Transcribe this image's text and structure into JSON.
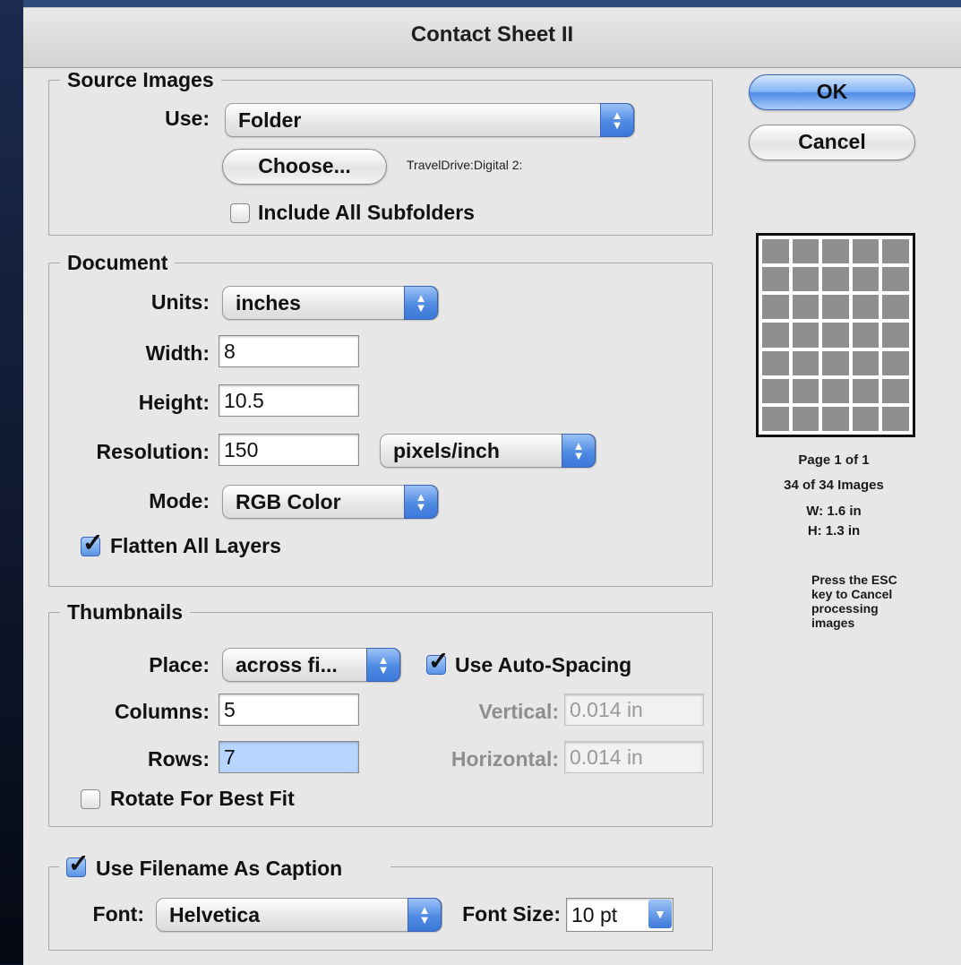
{
  "window": {
    "title": "Contact Sheet II"
  },
  "buttons": {
    "ok": "OK",
    "cancel": "Cancel"
  },
  "source_images": {
    "legend": "Source Images",
    "use_label": "Use:",
    "use_value": "Folder",
    "choose_label": "Choose...",
    "path": "TravelDrive:Digital 2:",
    "include_subfolders": {
      "label": "Include All Subfolders",
      "checked": false
    }
  },
  "document": {
    "legend": "Document",
    "units_label": "Units:",
    "units_value": "inches",
    "width_label": "Width:",
    "width_value": "8",
    "height_label": "Height:",
    "height_value": "10.5",
    "resolution_label": "Resolution:",
    "resolution_value": "150",
    "resolution_units": "pixels/inch",
    "mode_label": "Mode:",
    "mode_value": "RGB Color",
    "flatten": {
      "label": "Flatten All Layers",
      "checked": true
    }
  },
  "thumbnails": {
    "legend": "Thumbnails",
    "place_label": "Place:",
    "place_value": "across fi...",
    "auto_spacing": {
      "label": "Use Auto-Spacing",
      "checked": true
    },
    "columns_label": "Columns:",
    "columns_value": "5",
    "rows_label": "Rows:",
    "rows_value": "7",
    "vertical_label": "Vertical:",
    "vertical_value": "0.014 in",
    "horizontal_label": "Horizontal:",
    "horizontal_value": "0.014 in",
    "rotate": {
      "label": "Rotate For Best Fit",
      "checked": false
    }
  },
  "caption": {
    "use_filename": {
      "label": "Use Filename As Caption",
      "checked": true
    },
    "font_label": "Font:",
    "font_value": "Helvetica",
    "font_size_label": "Font Size:",
    "font_size_value": "10 pt"
  },
  "preview": {
    "columns": 5,
    "rows": 7,
    "page": "Page 1 of 1",
    "images": "34 of 34 Images",
    "width": "W: 1.6 in",
    "height": "H: 1.3 in",
    "note": "Press the ESC key to Cancel processing images"
  }
}
